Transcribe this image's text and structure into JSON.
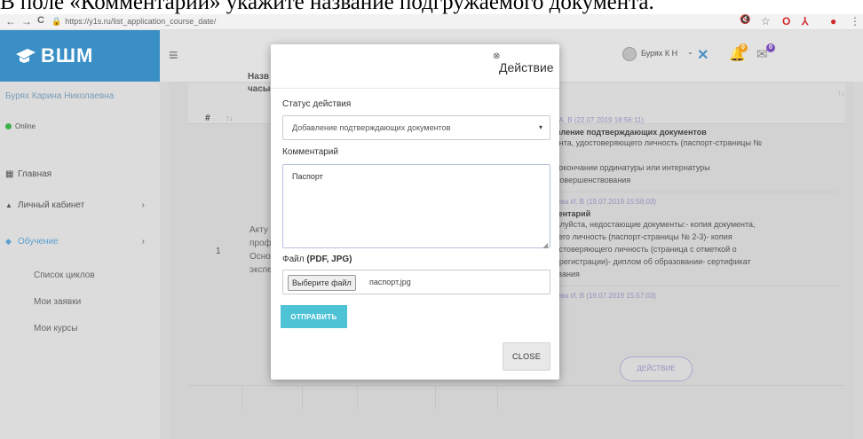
{
  "caption": "В поле «Комментарий» укажите название подгружаемого документа.",
  "browser": {
    "url": "https://y1s.ru/list_application_course_date/",
    "nav_back": "←",
    "nav_forward": "→",
    "nav_reload": "C",
    "lock": "🔒",
    "ext_icons": [
      "🔇",
      "☆",
      "O",
      "⅄",
      "●",
      "⋮"
    ]
  },
  "sidebar": {
    "brand": "ВШМ",
    "user_name": "Бурях Карина Николаевна",
    "status": "Online",
    "items": [
      {
        "label": "Главная",
        "icon": "dashboard-icon",
        "glyph": "▦"
      },
      {
        "label": "Личный кабинет",
        "icon": "user-icon",
        "glyph": "▲"
      },
      {
        "label": "Обучение",
        "icon": "graduation-icon",
        "glyph": "◆"
      }
    ],
    "chevron": "›",
    "sub_items": [
      "Список циклов",
      "Мои заявки",
      "Мои курсы"
    ]
  },
  "topbar": {
    "hamburger": "≡",
    "x_glyph": "✕",
    "bell_glyph": "🔔",
    "mail_glyph": "✉",
    "bell_badge": "0",
    "mail_badge": "0",
    "user": "Бурях К Н",
    "user_chevron": "⌄",
    "accent": "#3a8fc6"
  },
  "table": {
    "col_num": "#",
    "sort_glyph": "↑↓",
    "col_name_line1": "Назв",
    "col_name_line2": "часы",
    "row": {
      "num": "1",
      "text": [
        "Акту",
        "проф",
        "Осно",
        "экспе"
      ]
    }
  },
  "history": [
    {
      "author": "урин А. В (22.07.2019 18:56:11)",
      "title": "обавление подтверждающих документов",
      "lines": [
        "кумента, удостоверяющего личность (паспорт-страницы №",
        "",
        "т об окончании ординатуры или интернатуры",
        "ат усовершенствования"
      ]
    },
    {
      "author": "сильева И. В (19.07.2019 15:58:03)",
      "title": "омментарий",
      "lines": [
        "пожалуйста, недостающие документы:- копия документа,",
        "яющего личность (паспорт-страницы № 2-3)- копия",
        ", удостоверяющего личность (страница с отметкой о",
        "щей регистрации)- диплом об образовании- сертификат",
        "ствования"
      ]
    },
    {
      "author": "сильева И. В (19.07.2019 15:57:03)",
      "title": "",
      "lines": []
    }
  ],
  "history_action_button": "ДЕЙСТВИЕ",
  "modal": {
    "close_glyph": "⊗",
    "title": "Действие",
    "status_label": "Статус действия",
    "status_value": "Добавление подтверждающих документов",
    "select_caret": "▾",
    "comment_label": "Комментарий",
    "comment_value": "Паспорт",
    "file_label_prefix": "Файл",
    "file_label_formats": "(PDF, JPG)",
    "file_button": "Выберите файл",
    "file_name": "паспорт.jpg",
    "submit": "ОТПРАВИТЬ",
    "close": "CLOSE",
    "resize_glyph": "◢",
    "submit_color": "#4fc3d6"
  }
}
